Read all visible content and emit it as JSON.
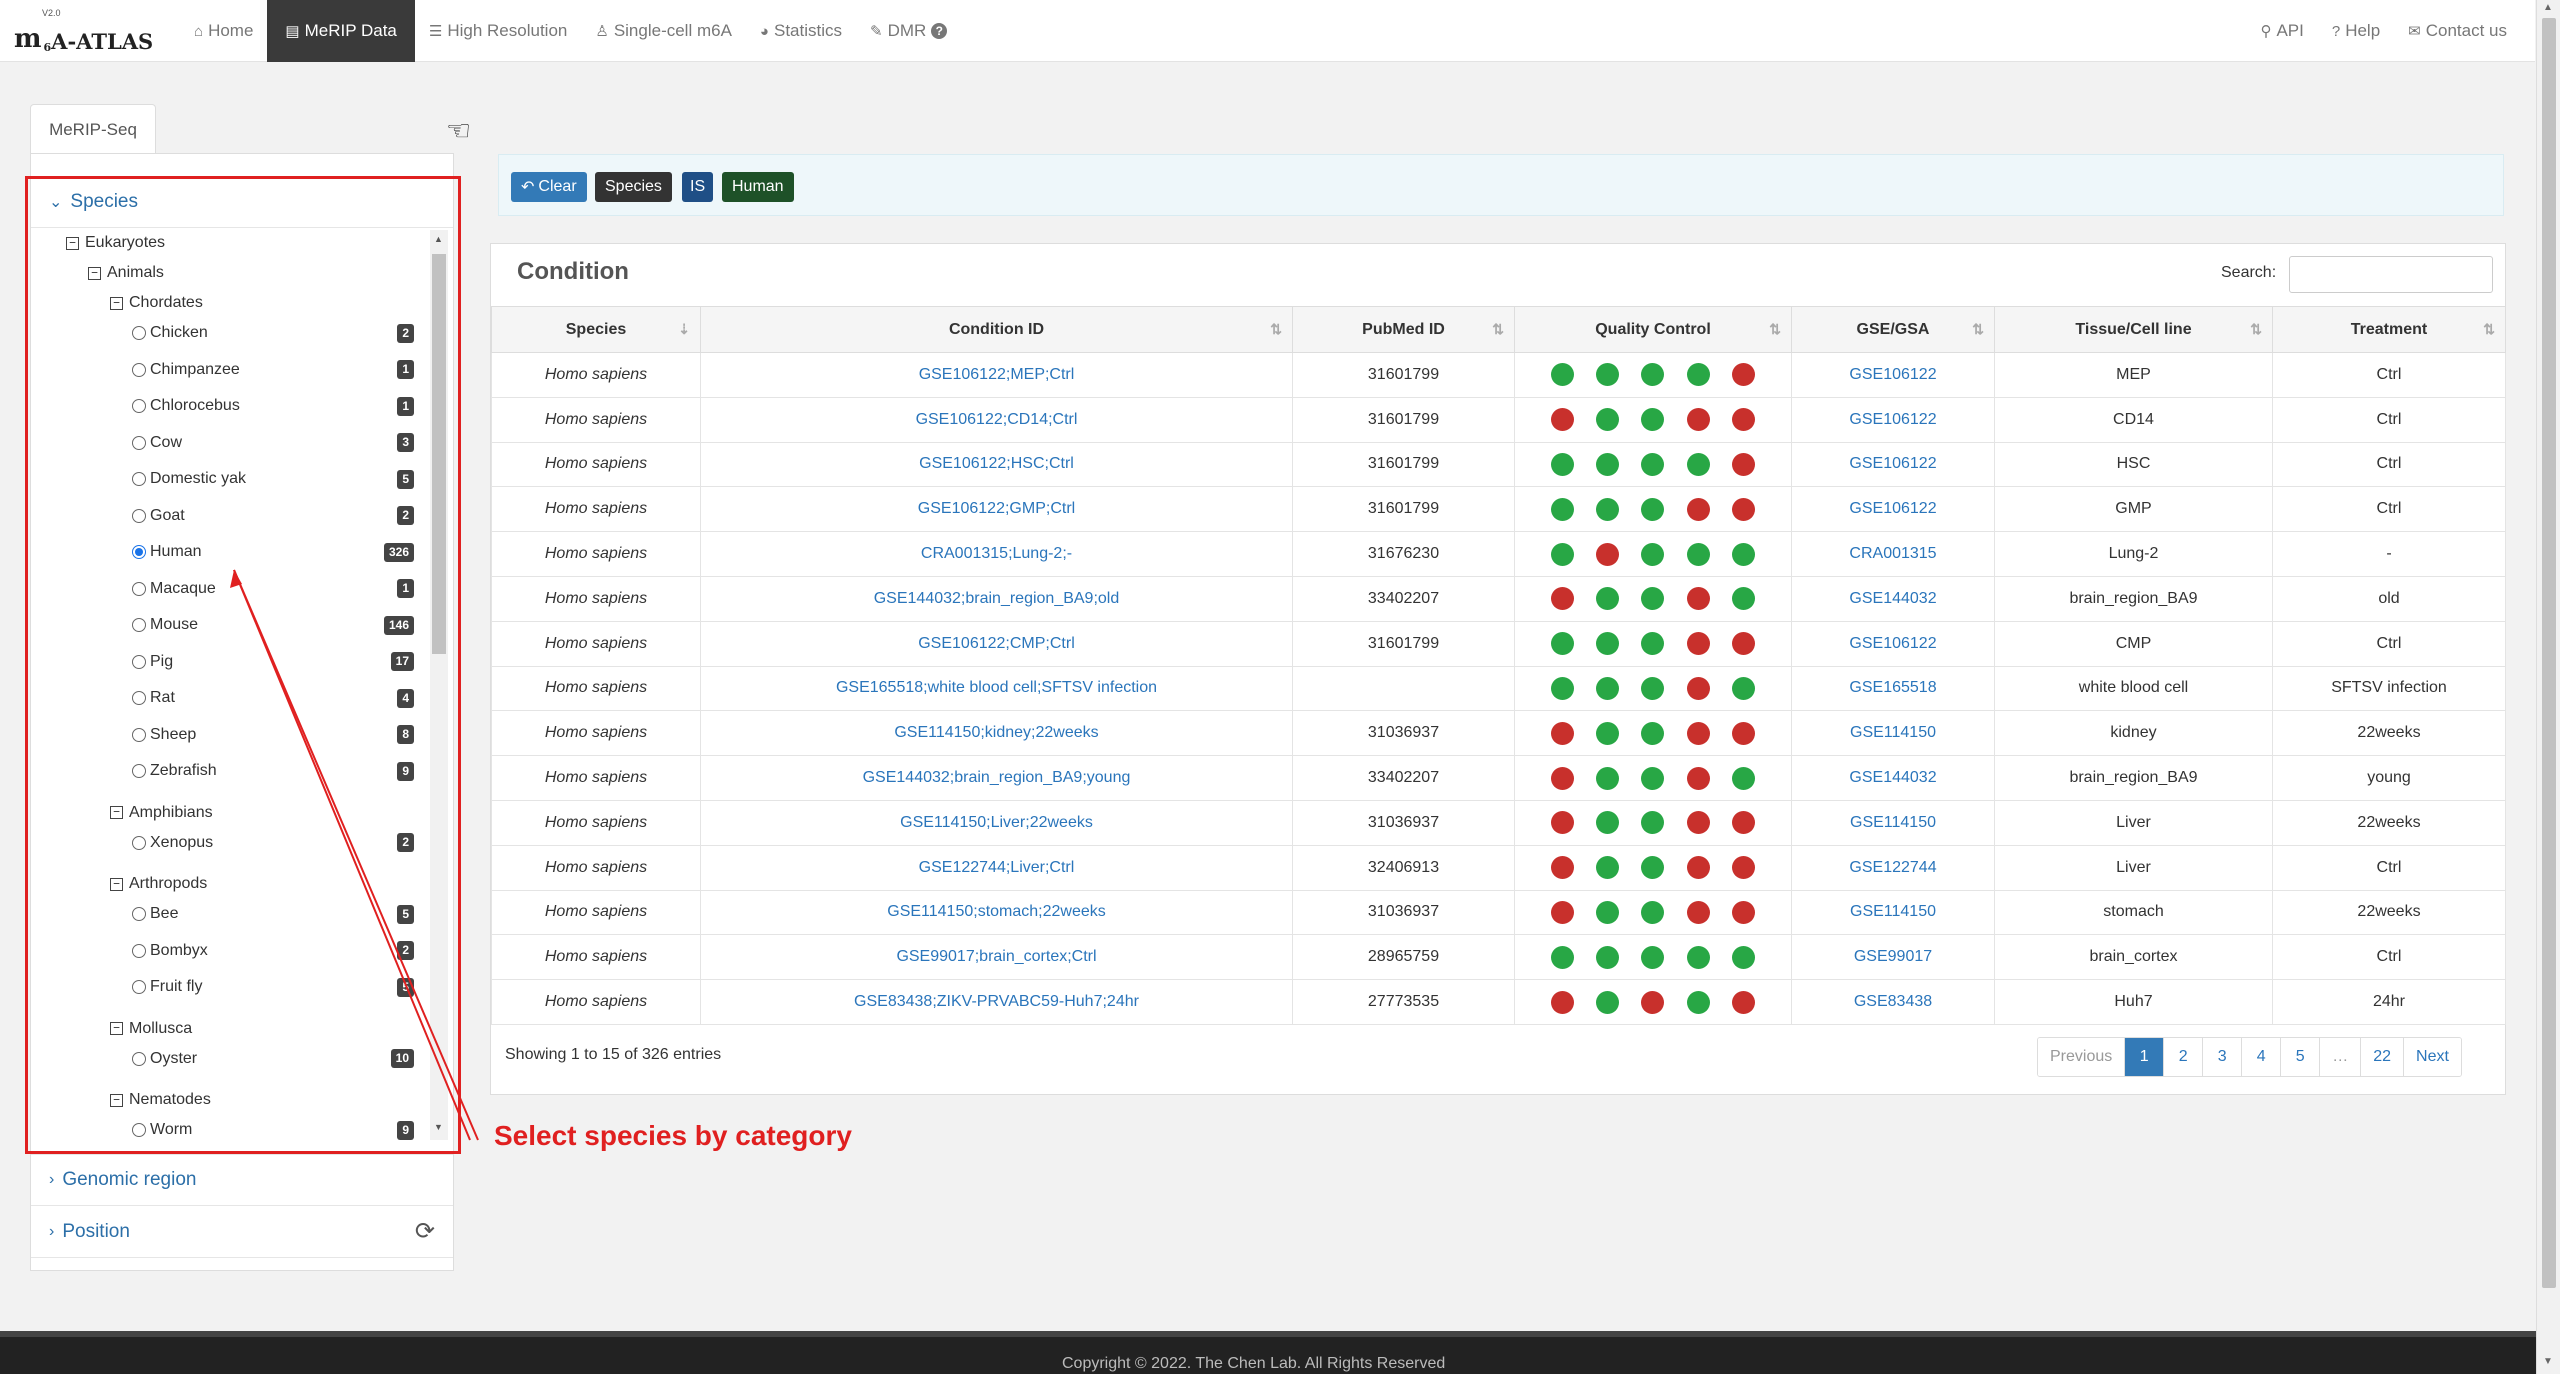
{
  "brand": {
    "prefix": "m",
    "sup": "6",
    "name": "A-ATLAS",
    "version": "V2.0"
  },
  "nav": [
    {
      "label": "Home",
      "icon": "home-icon",
      "glyph": "⌂"
    },
    {
      "label": "MeRIP Data",
      "icon": "table-icon",
      "glyph": "▤",
      "active": true
    },
    {
      "label": "High Resolution",
      "icon": "sliders-icon",
      "glyph": "☰"
    },
    {
      "label": "Single-cell m6A",
      "icon": "flask-icon",
      "glyph": "♙"
    },
    {
      "label": "Statistics",
      "icon": "pie-chart-icon",
      "glyph": "◕"
    },
    {
      "label": "DMR",
      "icon": "wrench-icon",
      "glyph": "✎",
      "help": "?"
    }
  ],
  "nav_right": [
    {
      "label": "API",
      "icon": "link-icon",
      "glyph": "⚲"
    },
    {
      "label": "Help",
      "icon": "question-icon",
      "glyph": "?"
    },
    {
      "label": "Contact us",
      "icon": "envelope-icon",
      "glyph": "✉"
    }
  ],
  "left": {
    "tab": "MeRIP-Seq",
    "species_header": "Species",
    "genomic_header": "Genomic region",
    "position_header": "Position"
  },
  "tree": {
    "root": "Eukaryotes",
    "animals": "Animals",
    "groups": [
      {
        "name": "Chordates",
        "items": [
          {
            "name": "Chicken",
            "count": "2"
          },
          {
            "name": "Chimpanzee",
            "count": "1"
          },
          {
            "name": "Chlorocebus",
            "count": "1"
          },
          {
            "name": "Cow",
            "count": "3"
          },
          {
            "name": "Domestic yak",
            "count": "5"
          },
          {
            "name": "Goat",
            "count": "2"
          },
          {
            "name": "Human",
            "count": "326",
            "selected": true
          },
          {
            "name": "Macaque",
            "count": "1"
          },
          {
            "name": "Mouse",
            "count": "146"
          },
          {
            "name": "Pig",
            "count": "17"
          },
          {
            "name": "Rat",
            "count": "4"
          },
          {
            "name": "Sheep",
            "count": "8"
          },
          {
            "name": "Zebrafish",
            "count": "9"
          }
        ]
      },
      {
        "name": "Amphibians",
        "items": [
          {
            "name": "Xenopus",
            "count": "2"
          }
        ]
      },
      {
        "name": "Arthropods",
        "items": [
          {
            "name": "Bee",
            "count": "5"
          },
          {
            "name": "Bombyx",
            "count": "2"
          },
          {
            "name": "Fruit fly",
            "count": "5"
          }
        ]
      },
      {
        "name": "Mollusca",
        "items": [
          {
            "name": "Oyster",
            "count": "10"
          }
        ]
      },
      {
        "name": "Nematodes",
        "items": [
          {
            "name": "Worm",
            "count": "9"
          }
        ]
      }
    ]
  },
  "filters": {
    "clear": "Clear",
    "chips": [
      "Species",
      "IS",
      "Human"
    ]
  },
  "annotation": "Select species by category",
  "table": {
    "title": "Condition",
    "search_label": "Search:",
    "columns": [
      "Species",
      "Condition ID",
      "PubMed ID",
      "Quality Control",
      "GSE/GSA",
      "Tissue/Cell line",
      "Treatment"
    ],
    "rows": [
      {
        "species": "Homo sapiens",
        "cond": "GSE106122;MEP;Ctrl",
        "pmid": "31601799",
        "qc": [
          "g",
          "g",
          "g",
          "g",
          "r"
        ],
        "gse": "GSE106122",
        "tissue": "MEP",
        "treat": "Ctrl"
      },
      {
        "species": "Homo sapiens",
        "cond": "GSE106122;CD14;Ctrl",
        "pmid": "31601799",
        "qc": [
          "r",
          "g",
          "g",
          "r",
          "r"
        ],
        "gse": "GSE106122",
        "tissue": "CD14",
        "treat": "Ctrl"
      },
      {
        "species": "Homo sapiens",
        "cond": "GSE106122;HSC;Ctrl",
        "pmid": "31601799",
        "qc": [
          "g",
          "g",
          "g",
          "g",
          "r"
        ],
        "gse": "GSE106122",
        "tissue": "HSC",
        "treat": "Ctrl"
      },
      {
        "species": "Homo sapiens",
        "cond": "GSE106122;GMP;Ctrl",
        "pmid": "31601799",
        "qc": [
          "g",
          "g",
          "g",
          "r",
          "r"
        ],
        "gse": "GSE106122",
        "tissue": "GMP",
        "treat": "Ctrl"
      },
      {
        "species": "Homo sapiens",
        "cond": "CRA001315;Lung-2;-",
        "pmid": "31676230",
        "qc": [
          "g",
          "r",
          "g",
          "g",
          "g"
        ],
        "gse": "CRA001315",
        "tissue": "Lung-2",
        "treat": "-"
      },
      {
        "species": "Homo sapiens",
        "cond": "GSE144032;brain_region_BA9;old",
        "pmid": "33402207",
        "qc": [
          "r",
          "g",
          "g",
          "r",
          "g"
        ],
        "gse": "GSE144032",
        "tissue": "brain_region_BA9",
        "treat": "old"
      },
      {
        "species": "Homo sapiens",
        "cond": "GSE106122;CMP;Ctrl",
        "pmid": "31601799",
        "qc": [
          "g",
          "g",
          "g",
          "r",
          "r"
        ],
        "gse": "GSE106122",
        "tissue": "CMP",
        "treat": "Ctrl"
      },
      {
        "species": "Homo sapiens",
        "cond": "GSE165518;white blood cell;SFTSV infection",
        "pmid": "",
        "qc": [
          "g",
          "g",
          "g",
          "r",
          "g"
        ],
        "gse": "GSE165518",
        "tissue": "white blood cell",
        "treat": "SFTSV infection"
      },
      {
        "species": "Homo sapiens",
        "cond": "GSE114150;kidney;22weeks",
        "pmid": "31036937",
        "qc": [
          "r",
          "g",
          "g",
          "r",
          "r"
        ],
        "gse": "GSE114150",
        "tissue": "kidney",
        "treat": "22weeks"
      },
      {
        "species": "Homo sapiens",
        "cond": "GSE144032;brain_region_BA9;young",
        "pmid": "33402207",
        "qc": [
          "r",
          "g",
          "g",
          "r",
          "g"
        ],
        "gse": "GSE144032",
        "tissue": "brain_region_BA9",
        "treat": "young"
      },
      {
        "species": "Homo sapiens",
        "cond": "GSE114150;Liver;22weeks",
        "pmid": "31036937",
        "qc": [
          "r",
          "g",
          "g",
          "r",
          "r"
        ],
        "gse": "GSE114150",
        "tissue": "Liver",
        "treat": "22weeks"
      },
      {
        "species": "Homo sapiens",
        "cond": "GSE122744;Liver;Ctrl",
        "pmid": "32406913",
        "qc": [
          "r",
          "g",
          "g",
          "r",
          "r"
        ],
        "gse": "GSE122744",
        "tissue": "Liver",
        "treat": "Ctrl"
      },
      {
        "species": "Homo sapiens",
        "cond": "GSE114150;stomach;22weeks",
        "pmid": "31036937",
        "qc": [
          "r",
          "g",
          "g",
          "r",
          "r"
        ],
        "gse": "GSE114150",
        "tissue": "stomach",
        "treat": "22weeks"
      },
      {
        "species": "Homo sapiens",
        "cond": "GSE99017;brain_cortex;Ctrl",
        "pmid": "28965759",
        "qc": [
          "g",
          "g",
          "g",
          "g",
          "g"
        ],
        "gse": "GSE99017",
        "tissue": "brain_cortex",
        "treat": "Ctrl"
      },
      {
        "species": "Homo sapiens",
        "cond": "GSE83438;ZIKV-PRVABC59-Huh7;24hr",
        "pmid": "27773535",
        "qc": [
          "r",
          "g",
          "r",
          "g",
          "r"
        ],
        "gse": "GSE83438",
        "tissue": "Huh7",
        "treat": "24hr"
      }
    ],
    "showing": "Showing 1 to 15 of 326 entries",
    "pager": [
      "Previous",
      "1",
      "2",
      "3",
      "4",
      "5",
      "…",
      "22",
      "Next"
    ]
  },
  "colors": {
    "qc_good": "#28a745",
    "qc_bad": "#c8302c",
    "accent": "#337ab7",
    "annotation": "#e02020"
  },
  "footer": "Copyright © 2022. The Chen Lab. All Rights Reserved"
}
